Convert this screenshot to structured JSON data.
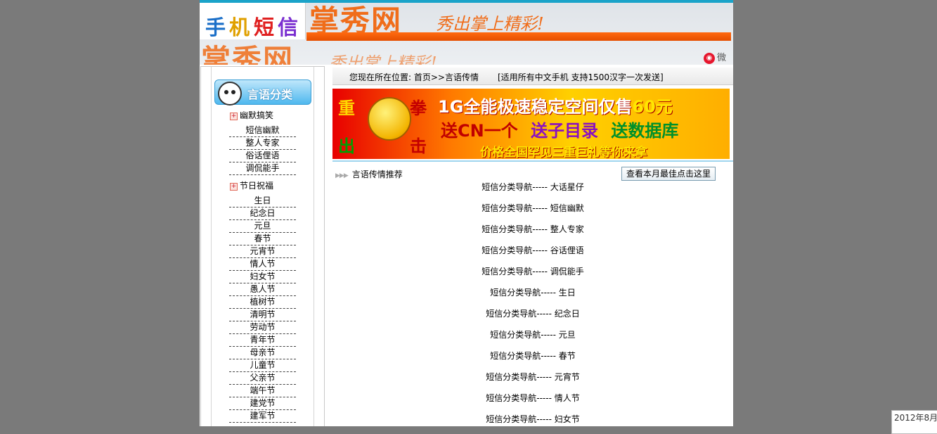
{
  "header": {
    "logo_chars": [
      "手",
      "机",
      "短",
      "信"
    ],
    "logo_colors": [
      "#1b6fc8",
      "#e0a000",
      "#e02020",
      "#7a2ed0"
    ],
    "site_name": "掌秀网",
    "slogan": "秀出掌上精彩!",
    "weibo_label": "微博"
  },
  "sidebar": {
    "title": "言语分类",
    "groups": [
      {
        "title": "幽默搞笑",
        "items": [
          "短信幽默",
          "整人专家",
          "俗话俚语",
          "调侃能手"
        ]
      },
      {
        "title": "节日祝福",
        "items": [
          "生日",
          "纪念日",
          "元旦",
          "春节",
          "元宵节",
          "情人节",
          "妇女节",
          "愚人节",
          "植树节",
          "清明节",
          "劳动节",
          "青年节",
          "母亲节",
          "儿童节",
          "父亲节",
          "端午节",
          "建党节",
          "建军节"
        ]
      }
    ]
  },
  "main": {
    "breadcrumb": "您现在所在位置: 首页>>言语传情",
    "support_note": "[适用所有中文手机 支持1500汉字一次发送]",
    "banner": {
      "chars": [
        "重",
        "拳",
        "出",
        "击"
      ],
      "line1_main": "1G全能极速稳定空间仅售",
      "line1_price": "60元",
      "line2": [
        "送CN一个",
        "送子目录",
        "送数据库"
      ],
      "line3": "价格全国罕见三重巨礼等你来拿"
    },
    "recommend_title": "言语传情推荐",
    "best_button": "查看本月最佳点击这里",
    "recommend_items": [
      "短信分类导航----- 大话星仔",
      "短信分类导航----- 短信幽默",
      "短信分类导航----- 整人专家",
      "短信分类导航----- 谷话俚语",
      "短信分类导航----- 调侃能手",
      "短信分类导航----- 生日",
      "短信分类导航----- 纪念日",
      "短信分类导航----- 元旦",
      "短信分类导航----- 春节",
      "短信分类导航----- 元宵节",
      "短信分类导航----- 情人节",
      "短信分类导航----- 妇女节"
    ]
  },
  "status": {
    "date": "2012年8月"
  }
}
